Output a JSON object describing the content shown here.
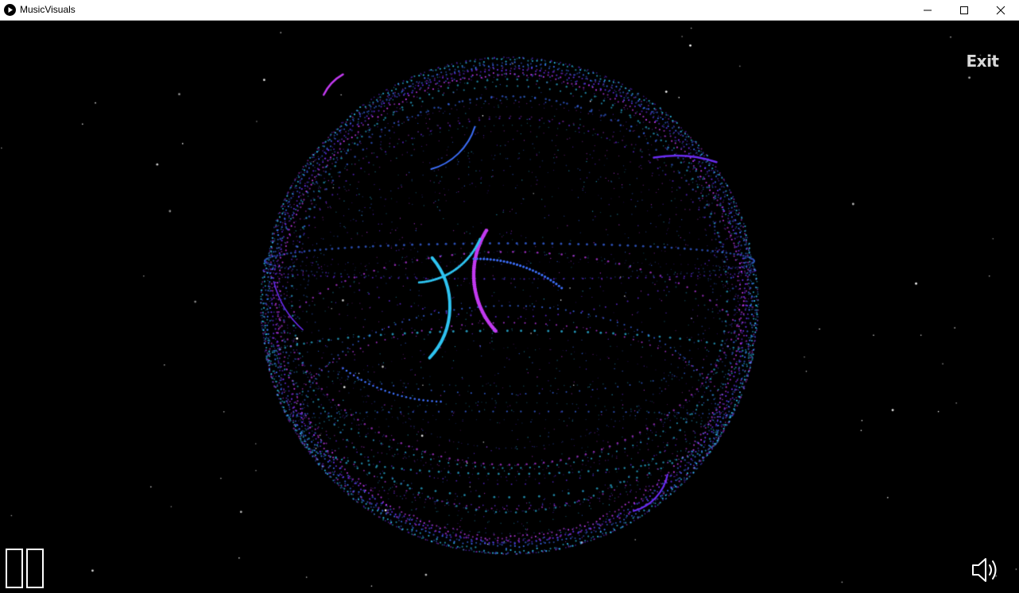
{
  "window": {
    "title": "MusicVisuals",
    "icon": "play-circle-icon",
    "controls": [
      "minimize-icon",
      "maximize-icon",
      "close-icon"
    ]
  },
  "overlay": {
    "exit_label": "Exit",
    "pause_icon": "pause-icon",
    "volume_icon": "volume-icon"
  },
  "colors": {
    "background": "#000000",
    "cyan": "#2ec3f0",
    "blue": "#3b6cf5",
    "violet": "#6a2cf0",
    "magenta": "#c23af0",
    "star": "#ffffff",
    "exit_text": "#d9d9d9"
  }
}
